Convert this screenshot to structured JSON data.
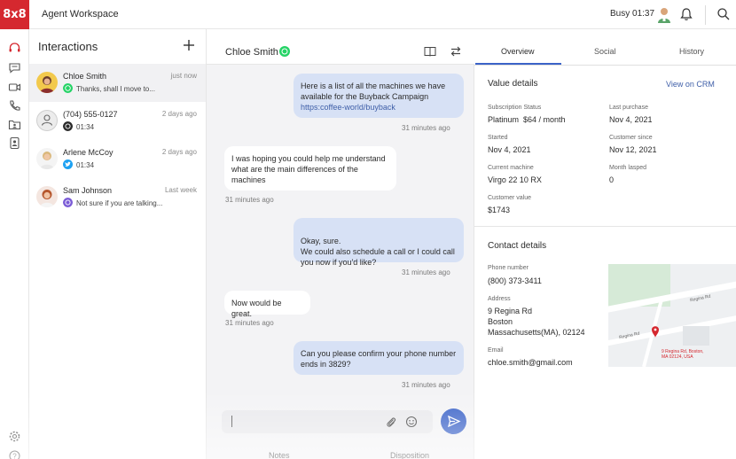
{
  "app": {
    "logo": "8x8",
    "title": "Agent Workspace"
  },
  "topbar": {
    "status": "Busy 01:37"
  },
  "interactions": {
    "title": "Interactions",
    "contacts": [
      {
        "name": "Chloe Smith",
        "time": "just now",
        "message": "Thanks, shall I move to...",
        "channel": "whatsapp",
        "channel_color": "#25d366"
      },
      {
        "name": "(704) 555-0127",
        "time": "2 days ago",
        "message": "01:34",
        "channel": "phone",
        "channel_color": "#2b2b2b"
      },
      {
        "name": "Arlene McCoy",
        "time": "2 days ago",
        "message": "01:34",
        "channel": "twitter",
        "channel_color": "#1da1f2"
      },
      {
        "name": "Sam Johnson",
        "time": "Last week",
        "message": "Not sure if you are talking...",
        "channel": "viber",
        "channel_color": "#7b5cd6"
      }
    ]
  },
  "chat": {
    "contact_name": "Chloe Smith",
    "messages": [
      {
        "dir": "out",
        "text": "Here is a list of all the machines we have available for the Buyback Campaign",
        "link": "https:coffee-world/buyback",
        "time": "31 minutes ago"
      },
      {
        "dir": "in",
        "text": "I was hoping you could help me understand what are the main differences of the machines",
        "time": "31 minutes ago"
      },
      {
        "dir": "out",
        "text": "Okay, sure.\nWe could also schedule a call or I could call you now if you'd like?",
        "time": "31 minutes ago"
      },
      {
        "dir": "in",
        "text": "Now would be great.",
        "time": "31 minutes ago"
      },
      {
        "dir": "out",
        "text": "Can you please confirm your phone number ends in 3829?",
        "time": "31 minutes ago"
      }
    ],
    "composer": {
      "placeholder": ""
    },
    "bottom_tabs": [
      "Notes",
      "Disposition"
    ]
  },
  "details": {
    "tabs": [
      "Overview",
      "Social",
      "History"
    ],
    "value_details": {
      "title": "Value details",
      "crm_link": "View on CRM",
      "fields": {
        "subscription_status": {
          "label": "Subscription Status",
          "value": "Platinum  $64 / month"
        },
        "last_purchase": {
          "label": "Last purchase",
          "value": "Nov 4, 2021"
        },
        "started": {
          "label": "Started",
          "value": "Nov 4, 2021"
        },
        "customer_since": {
          "label": "Customer since",
          "value": "Nov 12, 2021"
        },
        "current_machine": {
          "label": "Current machine",
          "value": "Virgo 22 10 RX"
        },
        "month_lasped": {
          "label": "Month lasped",
          "value": "0"
        },
        "customer_value": {
          "label": "Customer value",
          "value": "$1743"
        }
      }
    },
    "contact_details": {
      "title": "Contact details",
      "phone_label": "Phone number",
      "phone": "(800) 373-3411",
      "address_label": "Address",
      "address_line1": "9 Regina Rd",
      "address_line2": "Boston",
      "address_line3": "Massachusetts(MA), 02124",
      "email_label": "Email",
      "email": "chloe.smith@gmail.com",
      "map": {
        "street1": "Regina Rd",
        "street2": "Regina Rd",
        "pin_label": "9 Regina Rd, Boston, MA 02124, USA"
      }
    }
  }
}
